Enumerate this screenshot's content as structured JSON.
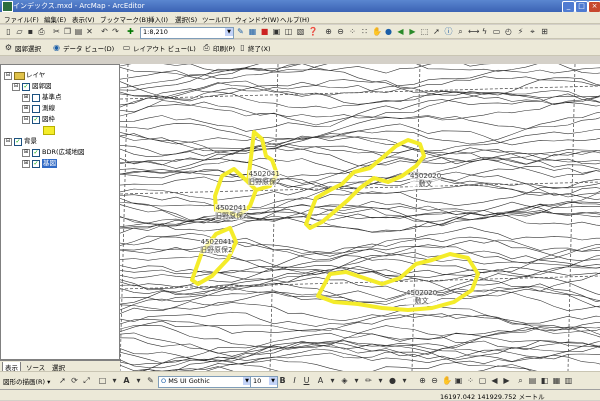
{
  "window": {
    "title": "インデックス.mxd - ArcMap - ArcEditor",
    "minimize": "_",
    "maximize": "□",
    "close": "×"
  },
  "menu": [
    "ファイル(F)",
    "編集(E)",
    "表示(V)",
    "ブックマーク(B)",
    "挿入(I)",
    "選択(S)",
    "ツール(T)",
    "ウィンドウ(W)",
    "ヘルプ(H)"
  ],
  "toolbar": {
    "scale": "1:8,210"
  },
  "toolbar2": {
    "georef": "図郭選択",
    "data_view": "データ ビュー(D)",
    "layout_view": "レイアウト ビュー(L)",
    "print": "印刷(P)",
    "exit": "終了(X)"
  },
  "toc": {
    "root": "レイヤ",
    "items": [
      {
        "label": "図郭図",
        "level": 1,
        "expand": "⊟",
        "checked": true
      },
      {
        "label": "基準点",
        "level": 2,
        "expand": "⊞",
        "checked": false
      },
      {
        "label": "測線",
        "level": 2,
        "expand": "⊞",
        "checked": false
      },
      {
        "label": "図枠",
        "level": 2,
        "expand": "⊟",
        "checked": true
      },
      {
        "label": "背景",
        "level": 1,
        "expand": "⊟",
        "checked": true
      },
      {
        "label": "BDR(広域地図",
        "level": 2,
        "expand": "⊞",
        "checked": true
      },
      {
        "label": "基図",
        "level": 2,
        "expand": "⊞",
        "checked": true
      }
    ],
    "tabs": [
      "表示",
      "ソース",
      "選択"
    ]
  },
  "map": {
    "labels": [
      {
        "id": "l1",
        "lines": [
          "4502041",
          "旧野原保2"
        ]
      },
      {
        "id": "l2",
        "lines": [
          "4502041",
          "旧野原保2"
        ]
      },
      {
        "id": "l3",
        "lines": [
          "4502041",
          "旧野原保2"
        ]
      },
      {
        "id": "l4",
        "lines": [
          "4502020",
          "敷文"
        ]
      },
      {
        "id": "l5",
        "lines": [
          "4502020",
          "敷文"
        ]
      }
    ],
    "polygon_color": "#f4ec2a"
  },
  "drawing": {
    "draw_label": "図形の描画(R) ▾",
    "font": "MS UI Gothic",
    "size": "10",
    "bold": "B",
    "italic": "I",
    "underline": "U"
  },
  "status": {
    "coords": "16197.042  141929.752 メートル"
  }
}
